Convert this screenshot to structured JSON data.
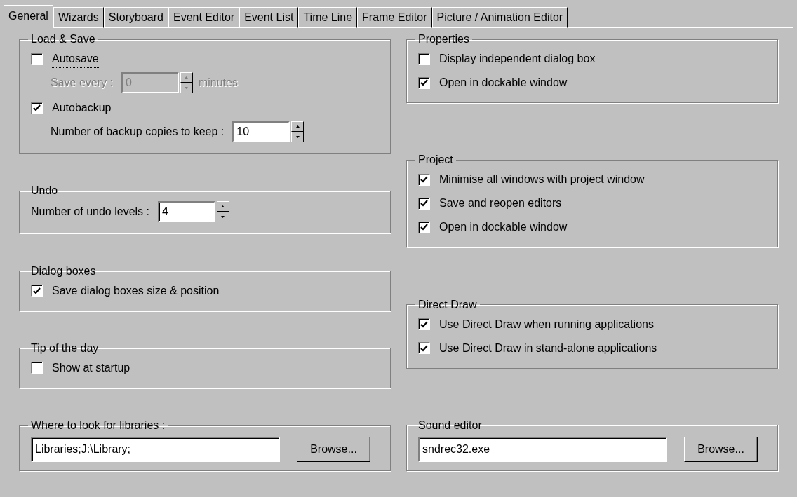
{
  "tabs": [
    {
      "label": "General",
      "selected": true
    },
    {
      "label": "Wizards",
      "selected": false
    },
    {
      "label": "Storyboard",
      "selected": false
    },
    {
      "label": "Event Editor",
      "selected": false
    },
    {
      "label": "Event List",
      "selected": false
    },
    {
      "label": "Time Line",
      "selected": false
    },
    {
      "label": "Frame Editor",
      "selected": false
    },
    {
      "label": "Picture / Animation Editor",
      "selected": false
    }
  ],
  "columns": [
    {
      "groups": [
        {
          "title": "Load & Save",
          "rows": [
            {
              "kind": "checkbox",
              "label": "Autosave",
              "checked": false,
              "focused": true,
              "children": [
                {
                  "kind": "spinner",
                  "label": "Save every :",
                  "value": "0",
                  "suffix": "minutes",
                  "disabled": true
                }
              ]
            },
            {
              "kind": "checkbox",
              "label": "Autobackup",
              "checked": true,
              "focused": false,
              "children": [
                {
                  "kind": "spinner",
                  "label": "Number of backup copies to keep :",
                  "value": "10",
                  "disabled": false
                }
              ]
            }
          ]
        },
        {
          "title": "Undo",
          "rows": [
            {
              "kind": "spinner",
              "label": "Number of undo levels :",
              "value": "4",
              "disabled": false
            }
          ]
        },
        {
          "title": "Dialog boxes",
          "rows": [
            {
              "kind": "checkbox",
              "label": "Save dialog boxes size & position",
              "checked": true,
              "focused": false
            }
          ]
        },
        {
          "title": "Tip of the day",
          "rows": [
            {
              "kind": "checkbox",
              "label": "Show at startup",
              "checked": false,
              "focused": false
            }
          ]
        },
        {
          "title": "Where to look for libraries :",
          "rows": [
            {
              "kind": "path",
              "value": "Libraries;J:\\Library;",
              "button": "Browse..."
            }
          ]
        }
      ]
    },
    {
      "groups": [
        {
          "title": "Properties",
          "rows": [
            {
              "kind": "checkbox",
              "label": "Display independent dialog box",
              "checked": false,
              "focused": false
            },
            {
              "kind": "checkbox",
              "label": "Open in dockable window",
              "checked": true,
              "focused": false
            }
          ]
        },
        {
          "title": "Project",
          "rows": [
            {
              "kind": "checkbox",
              "label": "Minimise all windows with project window",
              "checked": true,
              "focused": false
            },
            {
              "kind": "checkbox",
              "label": "Save and reopen editors",
              "checked": true,
              "focused": false
            },
            {
              "kind": "checkbox",
              "label": "Open in dockable window",
              "checked": true,
              "focused": false
            }
          ]
        },
        {
          "title": "Direct Draw",
          "rows": [
            {
              "kind": "checkbox",
              "label": "Use Direct Draw when running applications",
              "checked": true,
              "focused": false
            },
            {
              "kind": "checkbox",
              "label": "Use Direct Draw in stand-alone applications",
              "checked": true,
              "focused": false
            }
          ]
        },
        {
          "title": "Sound editor",
          "rows": [
            {
              "kind": "path",
              "value": "sndrec32.exe",
              "button": "Browse..."
            }
          ]
        }
      ]
    }
  ]
}
